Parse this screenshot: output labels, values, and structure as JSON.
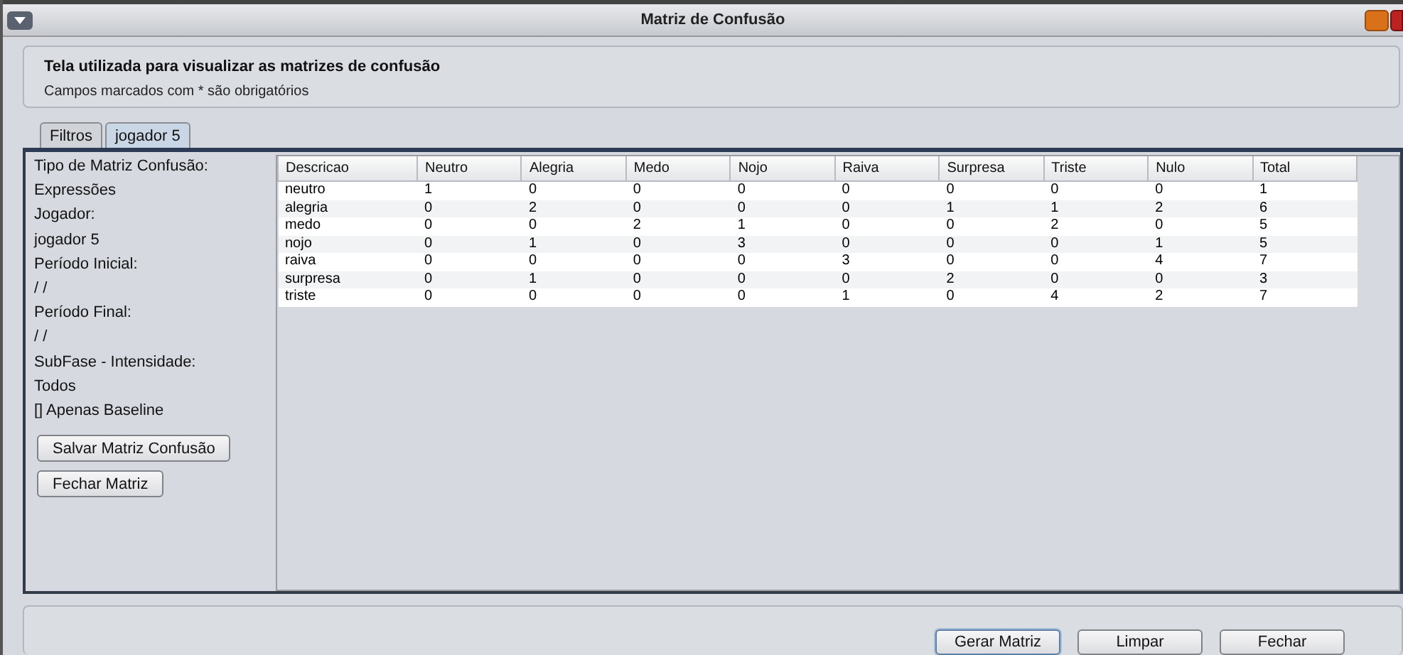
{
  "window": {
    "title": "Matriz de Confusão"
  },
  "header": {
    "title": "Tela utilizada para visualizar as matrizes de confusão",
    "subtitle": "Campos marcados com * são obrigatórios"
  },
  "tabs": [
    {
      "label": "Filtros",
      "selected": false
    },
    {
      "label": "jogador 5",
      "selected": true
    }
  ],
  "filters": [
    "Tipo de Matriz Confusão:",
    "Expressões",
    "Jogador:",
    "jogador 5",
    "Período Inicial:",
    " / /",
    "Período Final:",
    " / /",
    "SubFase - Intensidade:",
    "Todos",
    "[] Apenas Baseline"
  ],
  "side_buttons": [
    "Salvar Matriz Confusão",
    "Fechar Matriz"
  ],
  "table": {
    "columns": [
      "Descricao",
      "Neutro",
      "Alegria",
      "Medo",
      "Nojo",
      "Raiva",
      "Surpresa",
      "Triste",
      "Nulo",
      "Total"
    ],
    "rows": [
      [
        "neutro",
        "1",
        "0",
        "0",
        "0",
        "0",
        "0",
        "0",
        "0",
        "1"
      ],
      [
        "alegria",
        "0",
        "2",
        "0",
        "0",
        "0",
        "1",
        "1",
        "2",
        "6"
      ],
      [
        "medo",
        "0",
        "0",
        "2",
        "1",
        "0",
        "0",
        "2",
        "0",
        "5"
      ],
      [
        "nojo",
        "0",
        "1",
        "0",
        "3",
        "0",
        "0",
        "0",
        "1",
        "5"
      ],
      [
        "raiva",
        "0",
        "0",
        "0",
        "0",
        "3",
        "0",
        "0",
        "4",
        "7"
      ],
      [
        "surpresa",
        "0",
        "1",
        "0",
        "0",
        "0",
        "2",
        "0",
        "0",
        "3"
      ],
      [
        "triste",
        "0",
        "0",
        "0",
        "0",
        "1",
        "0",
        "4",
        "2",
        "7"
      ]
    ]
  },
  "buttons": [
    {
      "label": "Gerar Matriz",
      "focused": true
    },
    {
      "label": "Limpar",
      "focused": false
    },
    {
      "label": "Fechar",
      "focused": false
    }
  ]
}
